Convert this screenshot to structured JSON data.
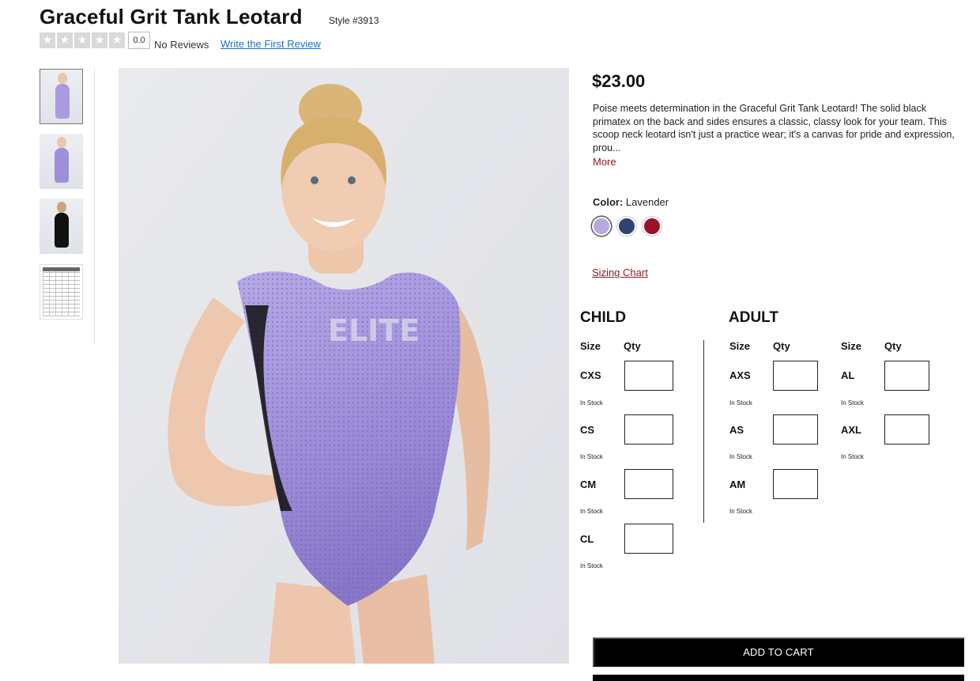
{
  "product": {
    "title": "Graceful Grit Tank Leotard",
    "style": "Style #3913",
    "price": "$23.00",
    "description": "Poise meets determination in the Graceful Grit Tank Leotard! The solid black primatex on the back and sides ensures a classic, classy look for your team. This scoop neck leotard isn't just a practice wear; it's a canvas for pride and expression, prou...",
    "more_label": "More"
  },
  "reviews": {
    "stars": 5,
    "score": "0.0",
    "count_label": "No Reviews",
    "write_label": "Write the First Review"
  },
  "gallery": {
    "thumbnails": [
      "front-lavender",
      "arms-crossed-lavender",
      "back-black",
      "sizing-chart"
    ],
    "active_index": 0
  },
  "color": {
    "label": "Color:",
    "selected": "Lavender",
    "swatches": [
      {
        "name": "Lavender",
        "hex": "#b8a8e0"
      },
      {
        "name": "Navy",
        "hex": "#2f4570"
      },
      {
        "name": "Red",
        "hex": "#9a1229"
      }
    ]
  },
  "sizing_chart_label": "Sizing Chart",
  "child": {
    "title": "CHILD",
    "size_header": "Size",
    "qty_header": "Qty",
    "sizes": [
      {
        "label": "CXS",
        "stock": "In Stock"
      },
      {
        "label": "CS",
        "stock": "In Stock"
      },
      {
        "label": "CM",
        "stock": "In Stock"
      },
      {
        "label": "CL",
        "stock": "In Stock"
      }
    ]
  },
  "adult": {
    "title": "ADULT",
    "size_header": "Size",
    "qty_header": "Qty",
    "col1": [
      {
        "label": "AXS",
        "stock": "In Stock"
      },
      {
        "label": "AS",
        "stock": "In Stock"
      },
      {
        "label": "AM",
        "stock": "In Stock"
      }
    ],
    "col2": [
      {
        "label": "AL",
        "stock": "In Stock"
      },
      {
        "label": "AXL",
        "stock": "In Stock"
      }
    ]
  },
  "add_to_cart_label": "ADD TO CART",
  "colors": {
    "accent_red": "#8b1a1a",
    "link_blue": "#1a73c7",
    "button_black": "#000000",
    "leotard_lavender": "#a99be0"
  }
}
